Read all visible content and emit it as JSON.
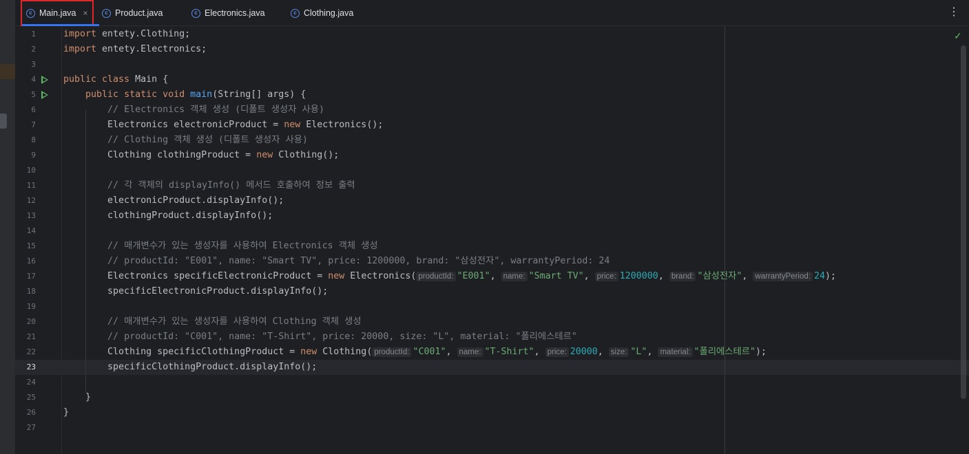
{
  "tabs": [
    {
      "label": "Main.java",
      "active": true,
      "icon": "class-icon"
    },
    {
      "label": "Product.java",
      "icon": "class-icon"
    },
    {
      "label": "Electronics.java",
      "icon": "class-icon"
    },
    {
      "label": "Clothing.java",
      "icon": "class-icon"
    }
  ],
  "tab_close": "×",
  "more_menu": "⋮",
  "inspection_status": "✓",
  "editor": {
    "current_line": 23,
    "lines": [
      {
        "n": "1",
        "code": "<span class='kw'>import</span> entety.Clothing;"
      },
      {
        "n": "2",
        "code": "<span class='kw'>import</span> entety.Electronics;"
      },
      {
        "n": "3",
        "code": ""
      },
      {
        "n": "4",
        "run": true,
        "code": "<span class='kw'>public class</span> Main {"
      },
      {
        "n": "5",
        "run": true,
        "code": "    <span class='kw'>public static void</span> <span class='fn'>main</span>(String[] args) {"
      },
      {
        "n": "6",
        "code": "        <span class='cm'>// Electronics 객체 생성 (디폴트 생성자 사용)</span>"
      },
      {
        "n": "7",
        "code": "        Electronics electronicProduct = <span class='kw'>new</span> Electronics();"
      },
      {
        "n": "8",
        "code": "        <span class='cm'>// Clothing 객체 생성 (디폴트 생성자 사용)</span>"
      },
      {
        "n": "9",
        "code": "        Clothing clothingProduct = <span class='kw'>new</span> Clothing();"
      },
      {
        "n": "10",
        "code": ""
      },
      {
        "n": "11",
        "code": "        <span class='cm'>// 각 객체의 displayInfo() 메서드 호출하여 정보 출력</span>"
      },
      {
        "n": "12",
        "code": "        electronicProduct.displayInfo();"
      },
      {
        "n": "13",
        "code": "        clothingProduct.displayInfo();"
      },
      {
        "n": "14",
        "code": ""
      },
      {
        "n": "15",
        "code": "        <span class='cm'>// 매개변수가 있는 생성자를 사용하여 Electronics 객체 생성</span>"
      },
      {
        "n": "16",
        "code": "        <span class='cm'>// productId: \"E001\", name: \"Smart TV\", price: 1200000, brand: \"삼성전자\", warrantyPeriod: 24</span>"
      },
      {
        "n": "17",
        "code": "        Electronics specificElectronicProduct = <span class='kw'>new</span> Electronics(<span class='hint'>productId:</span><span class='st'>\"E001\"</span>, <span class='hint'>name:</span><span class='st'>\"Smart TV\"</span>, <span class='hint'>price:</span><span class='nm'>1200000</span>, <span class='hint'>brand:</span><span class='st'>\"삼성전자\"</span>, <span class='hint'>warrantyPeriod:</span><span class='nm'>24</span>);"
      },
      {
        "n": "18",
        "code": "        specificElectronicProduct.displayInfo();"
      },
      {
        "n": "19",
        "code": ""
      },
      {
        "n": "20",
        "code": "        <span class='cm'>// 매개변수가 있는 생성자를 사용하여 Clothing 객체 생성</span>"
      },
      {
        "n": "21",
        "code": "        <span class='cm'>// productId: \"C001\", name: \"T-Shirt\", price: 20000, size: \"L\", material: \"폴리에스테르\"</span>"
      },
      {
        "n": "22",
        "code": "        Clothing specificClothingProduct = <span class='kw'>new</span> Clothing(<span class='hint'>productId:</span><span class='st'>\"C001\"</span>, <span class='hint'>name:</span><span class='st'>\"T-Shirt\"</span>, <span class='hint'>price:</span><span class='nm'>20000</span>, <span class='hint'>size:</span><span class='st'>\"L\"</span>, <span class='hint'>material:</span><span class='st'>\"폴리에스테르\"</span>);"
      },
      {
        "n": "23",
        "code": "        specificClothingProduct.displayInfo();"
      },
      {
        "n": "24",
        "code": ""
      },
      {
        "n": "25",
        "code": "    }"
      },
      {
        "n": "26",
        "code": "}"
      },
      {
        "n": "27",
        "code": ""
      }
    ]
  }
}
